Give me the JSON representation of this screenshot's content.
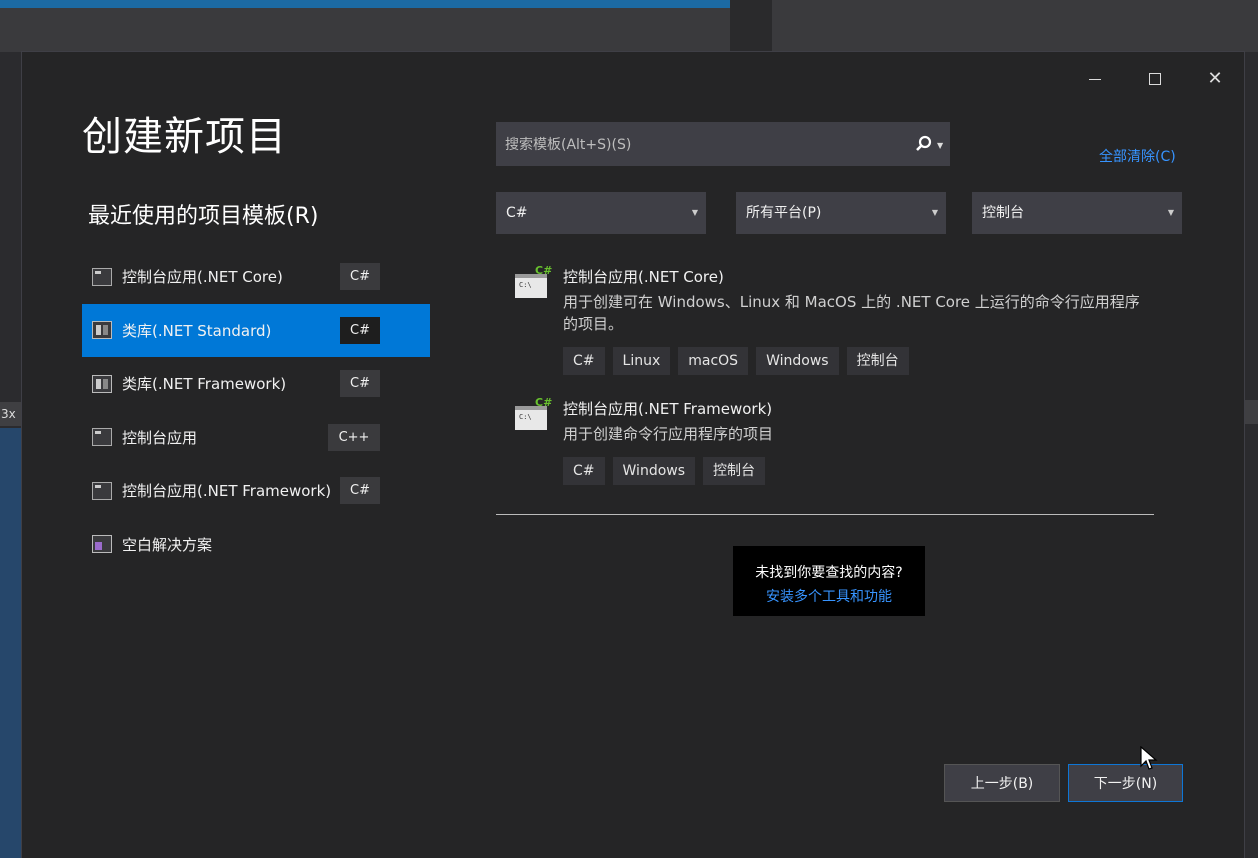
{
  "background": {
    "left_tab_label": "3x"
  },
  "window": {
    "minimize_icon": "minimize-icon",
    "maximize_icon": "maximize-icon",
    "close_label": "✕"
  },
  "title": "创建新项目",
  "recent": {
    "heading": "最近使用的项目模板(R)",
    "items": [
      {
        "label": "控制台应用(.NET Core)",
        "lang": "C#",
        "icon": "console-app-icon"
      },
      {
        "label": "类库(.NET Standard)",
        "lang": "C#",
        "icon": "class-library-icon",
        "selected": true
      },
      {
        "label": "类库(.NET Framework)",
        "lang": "C#",
        "icon": "class-library-icon"
      },
      {
        "label": "控制台应用",
        "lang": "C++",
        "icon": "console-app-icon"
      },
      {
        "label": "控制台应用(.NET Framework)",
        "lang": "C#",
        "icon": "console-app-icon"
      },
      {
        "label": "空白解决方案",
        "lang": "",
        "icon": "solution-icon"
      }
    ]
  },
  "search": {
    "placeholder": "搜索模板(Alt+S)(S)",
    "value": ""
  },
  "clear_all": "全部清除(C)",
  "filters": {
    "language": "C#",
    "platform": "所有平台(P)",
    "project_type": "控制台"
  },
  "templates": [
    {
      "name": "控制台应用(.NET Core)",
      "description": "用于创建可在 Windows、Linux 和 MacOS 上的 .NET Core 上运行的命令行应用程序的项目。",
      "tags": [
        "C#",
        "Linux",
        "macOS",
        "Windows",
        "控制台"
      ]
    },
    {
      "name": "控制台应用(.NET Framework)",
      "description": "用于创建命令行应用程序的项目",
      "tags": [
        "C#",
        "Windows",
        "控制台"
      ]
    }
  ],
  "not_found": {
    "question": "未找到你要查找的内容?",
    "link": "安装多个工具和功能"
  },
  "buttons": {
    "back": "上一步(B)",
    "next": "下一步(N)"
  },
  "colors": {
    "accent": "#0078d7",
    "link": "#3794ff",
    "dialog_bg": "#252526"
  }
}
